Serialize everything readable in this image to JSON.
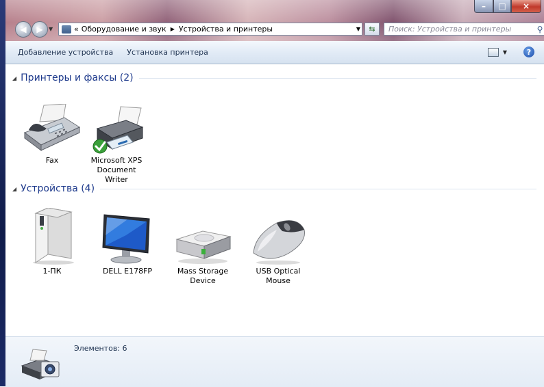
{
  "address_bar": {
    "overflow": "«",
    "crumbs": [
      "Оборудование и звук",
      "Устройства и принтеры"
    ]
  },
  "search": {
    "placeholder": "Поиск: Устройства и принтеры"
  },
  "toolbar": {
    "add_device": "Добавление устройства",
    "install_printer": "Установка принтера"
  },
  "groups": {
    "printers": {
      "title": "Принтеры и факсы (2)",
      "items": [
        {
          "line1": "Fax",
          "line2": ""
        },
        {
          "line1": "Microsoft XPS",
          "line2": "Document Writer"
        }
      ]
    },
    "devices": {
      "title": "Устройства (4)",
      "items": [
        {
          "line1": "1-ПК",
          "line2": ""
        },
        {
          "line1": "DELL E178FP",
          "line2": ""
        },
        {
          "line1": "Mass Storage",
          "line2": "Device"
        },
        {
          "line1": "USB Optical",
          "line2": "Mouse"
        }
      ]
    }
  },
  "details": {
    "count": "Элементов: 6"
  },
  "icons": {
    "nav_back": "back-arrow-icon",
    "nav_forward": "forward-arrow-icon",
    "refresh": "refresh-icon",
    "search": "search-icon",
    "help": "help-icon",
    "views": "change-view-icon"
  },
  "colors": {
    "group_title": "#1e3a8c",
    "toolbar_text": "#1e3250",
    "default_check": "#2e9a2e"
  }
}
